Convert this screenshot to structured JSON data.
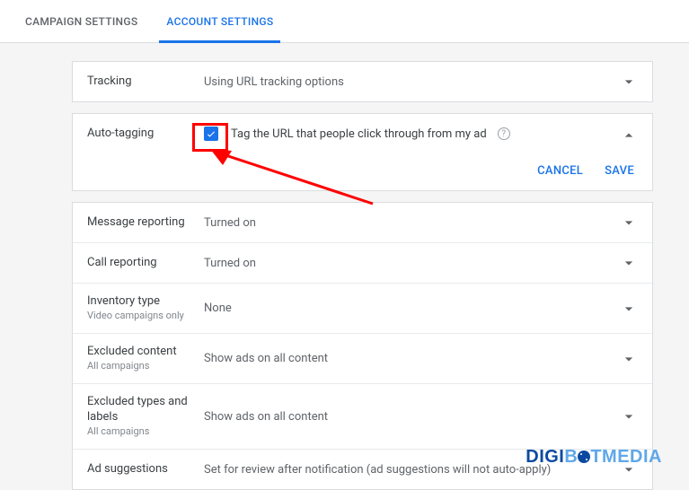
{
  "tabs": {
    "campaign": "Campaign Settings",
    "account": "Account Settings"
  },
  "tracking": {
    "label": "Tracking",
    "value": "Using URL tracking options"
  },
  "autoTagging": {
    "label": "Auto-tagging",
    "checkboxLabel": "Tag the URL that people click through from my ad",
    "cancel": "Cancel",
    "save": "Save"
  },
  "rows": [
    {
      "label": "Message reporting",
      "sub": "",
      "value": "Turned on"
    },
    {
      "label": "Call reporting",
      "sub": "",
      "value": "Turned on"
    },
    {
      "label": "Inventory type",
      "sub": "Video campaigns only",
      "value": "None"
    },
    {
      "label": "Excluded content",
      "sub": "All campaigns",
      "value": "Show ads on all content"
    },
    {
      "label": "Excluded types and labels",
      "sub": "All campaigns",
      "value": "Show ads on all content"
    },
    {
      "label": "Ad suggestions",
      "sub": "",
      "value": "Set for review after notification (ad suggestions will not auto-apply)"
    }
  ],
  "logo": {
    "a": "DIGI",
    "b": "B",
    "c": "TMEDIA"
  }
}
